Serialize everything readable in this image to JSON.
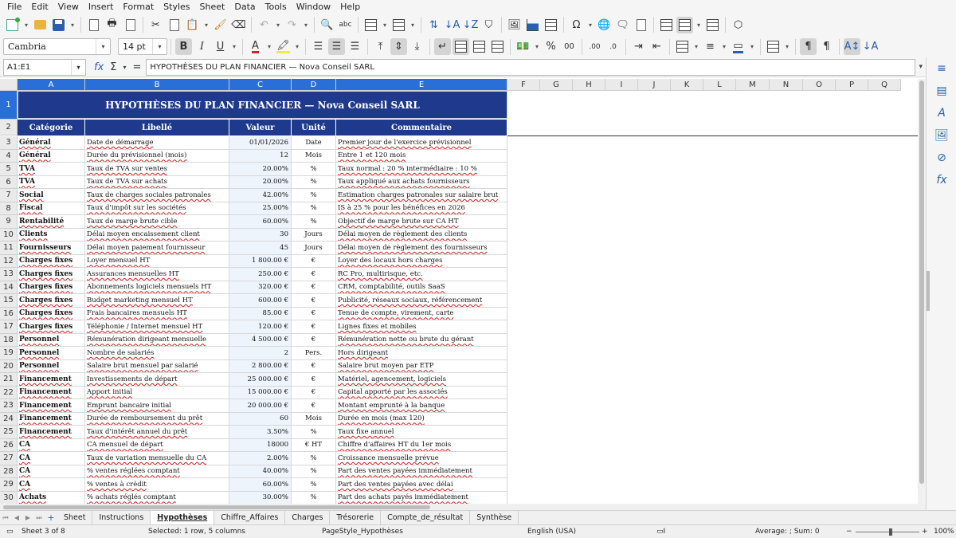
{
  "menu": [
    "File",
    "Edit",
    "View",
    "Insert",
    "Format",
    "Styles",
    "Sheet",
    "Data",
    "Tools",
    "Window",
    "Help"
  ],
  "toolbar": {
    "font_name": "Cambria",
    "font_size": "14 pt",
    "bold": "B",
    "italic": "I",
    "underline": "U",
    "currency": "%",
    "decimals": "0.0",
    "decimals2": "00"
  },
  "formula": {
    "cell_ref": "A1:E1",
    "content": "HYPOTHÈSES DU PLAN FINANCIER — Nova Conseil SARL",
    "fx": "fx",
    "sigma": "Σ",
    "equals": "="
  },
  "columns": [
    "A",
    "B",
    "C",
    "D",
    "E",
    "F",
    "G",
    "H",
    "I",
    "J",
    "K",
    "L",
    "M",
    "N",
    "O",
    "P",
    "Q"
  ],
  "sheet": {
    "title": "HYPOTHÈSES DU PLAN FINANCIER — Nova Conseil SARL",
    "headers": [
      "Catégorie",
      "Libellé",
      "Valeur",
      "Unité",
      "Commentaire"
    ],
    "rows": [
      {
        "n": "3",
        "cat": "Général",
        "label": "Date de démarrage",
        "val": "01/01/2026",
        "unit": "Date",
        "comment": "Premier jour de l'exercice prévisionnel"
      },
      {
        "n": "4",
        "cat": "Général",
        "label": "Durée du prévisionnel (mois)",
        "val": "12",
        "unit": "Mois",
        "comment": "Entre 1 et 120 mois"
      },
      {
        "n": "5",
        "cat": "TVA",
        "label": "Taux de TVA sur ventes",
        "val": "20.00%",
        "unit": "%",
        "comment": "Taux normal : 20 % intermédiaire : 10 %"
      },
      {
        "n": "6",
        "cat": "TVA",
        "label": "Taux de TVA sur achats",
        "val": "20.00%",
        "unit": "%",
        "comment": "Taux appliqué aux achats fournisseurs"
      },
      {
        "n": "7",
        "cat": "Social",
        "label": "Taux de charges sociales patronales",
        "val": "42.00%",
        "unit": "%",
        "comment": "Estimation charges patronales sur salaire brut"
      },
      {
        "n": "8",
        "cat": "Fiscal",
        "label": "Taux d'impôt sur les sociétés",
        "val": "25.00%",
        "unit": "%",
        "comment": "IS à 25 % pour les bénéfices en 2026"
      },
      {
        "n": "9",
        "cat": "Rentabilité",
        "label": "Taux de marge brute cible",
        "val": "60.00%",
        "unit": "%",
        "comment": "Objectif de marge brute sur CA HT"
      },
      {
        "n": "10",
        "cat": "Clients",
        "label": "Délai moyen encaissement client",
        "val": "30",
        "unit": "Jours",
        "comment": "Délai moyen de règlement des clients"
      },
      {
        "n": "11",
        "cat": "Fournisseurs",
        "label": "Délai moyen paiement fournisseur",
        "val": "45",
        "unit": "Jours",
        "comment": "Délai moyen de règlement des fournisseurs"
      },
      {
        "n": "12",
        "cat": "Charges fixes",
        "label": "Loyer mensuel HT",
        "val": "1 800.00 €",
        "unit": "€",
        "comment": "Loyer des locaux hors charges"
      },
      {
        "n": "13",
        "cat": "Charges fixes",
        "label": "Assurances mensuelles HT",
        "val": "250.00 €",
        "unit": "€",
        "comment": "RC Pro, multirisque, etc."
      },
      {
        "n": "14",
        "cat": "Charges fixes",
        "label": "Abonnements logiciels mensuels HT",
        "val": "320.00 €",
        "unit": "€",
        "comment": "CRM, comptabilité, outils SaaS"
      },
      {
        "n": "15",
        "cat": "Charges fixes",
        "label": "Budget marketing mensuel HT",
        "val": "600.00 €",
        "unit": "€",
        "comment": "Publicité, réseaux sociaux, référencement"
      },
      {
        "n": "16",
        "cat": "Charges fixes",
        "label": "Frais bancaires mensuels HT",
        "val": "85.00 €",
        "unit": "€",
        "comment": "Tenue de compte, virement, carte"
      },
      {
        "n": "17",
        "cat": "Charges fixes",
        "label": "Téléphonie / Internet mensuel HT",
        "val": "120.00 €",
        "unit": "€",
        "comment": "Lignes fixes et mobiles"
      },
      {
        "n": "18",
        "cat": "Personnel",
        "label": "Rémunération dirigeant mensuelle",
        "val": "4 500.00 €",
        "unit": "€",
        "comment": "Rémunération nette ou brute du gérant"
      },
      {
        "n": "19",
        "cat": "Personnel",
        "label": "Nombre de salariés",
        "val": "2",
        "unit": "Pers.",
        "comment": "Hors dirigeant"
      },
      {
        "n": "20",
        "cat": "Personnel",
        "label": "Salaire brut mensuel par salarié",
        "val": "2 800.00 €",
        "unit": "€",
        "comment": "Salaire brut moyen par ETP"
      },
      {
        "n": "21",
        "cat": "Financement",
        "label": "Investissements de départ",
        "val": "25 000.00 €",
        "unit": "€",
        "comment": "Matériel, agencement, logiciels"
      },
      {
        "n": "22",
        "cat": "Financement",
        "label": "Apport initial",
        "val": "15 000.00 €",
        "unit": "€",
        "comment": "Capital apporté par les associés"
      },
      {
        "n": "23",
        "cat": "Financement",
        "label": "Emprunt bancaire initial",
        "val": "20 000.00 €",
        "unit": "€",
        "comment": "Montant emprunté à la banque"
      },
      {
        "n": "24",
        "cat": "Financement",
        "label": "Durée de remboursement du prêt",
        "val": "60",
        "unit": "Mois",
        "comment": "Durée en mois (max 120)"
      },
      {
        "n": "25",
        "cat": "Financement",
        "label": "Taux d'intérêt annuel du prêt",
        "val": "3.50%",
        "unit": "%",
        "comment": "Taux fixe annuel"
      },
      {
        "n": "26",
        "cat": "CA",
        "label": "CA mensuel de départ",
        "val": "18000",
        "unit": "€ HT",
        "comment": "Chiffre d'affaires HT du 1er mois"
      },
      {
        "n": "27",
        "cat": "CA",
        "label": "Taux de variation mensuelle du CA",
        "val": "2.00%",
        "unit": "%",
        "comment": "Croissance mensuelle prévue"
      },
      {
        "n": "28",
        "cat": "CA",
        "label": "% ventes réglées comptant",
        "val": "40.00%",
        "unit": "%",
        "comment": "Part des ventes payées immédiatement"
      },
      {
        "n": "29",
        "cat": "CA",
        "label": "% ventes à crédit",
        "val": "60.00%",
        "unit": "%",
        "comment": "Part des ventes payées avec délai"
      },
      {
        "n": "30",
        "cat": "Achats",
        "label": "% achats réglés comptant",
        "val": "30.00%",
        "unit": "%",
        "comment": "Part des achats payés immédiatement"
      }
    ]
  },
  "tabs": [
    "Sheet",
    "Instructions",
    "Hypothèses",
    "Chiffre_Affaires",
    "Charges",
    "Trésorerie",
    "Compte_de_résultat",
    "Synthèse"
  ],
  "active_tab": "Hypothèses",
  "status": {
    "sheet": "Sheet 3 of 8",
    "selection": "Selected: 1 row, 5 columns",
    "page_style": "PageStyle_Hypothèses",
    "language": "English (USA)",
    "summary": "Average: ; Sum: 0",
    "zoom": "100%"
  },
  "colors": {
    "header_bg": "#1f3a8c",
    "value_bg": "#eef4fc",
    "selection": "#2a6ed8"
  }
}
